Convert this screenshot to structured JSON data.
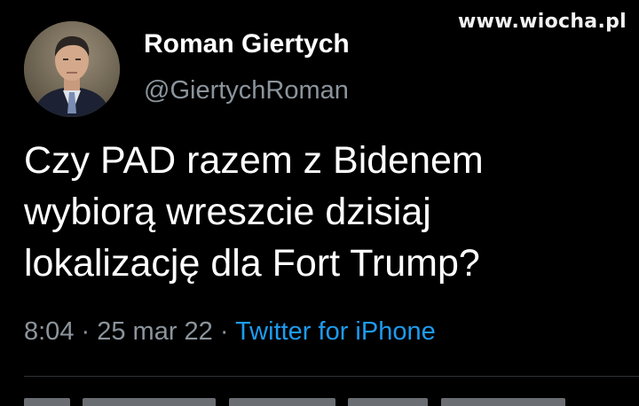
{
  "watermark": "www.wiocha.pl",
  "author": {
    "name": "Roman Giertych",
    "handle": "@GiertychRoman"
  },
  "tweet": {
    "lines": [
      "Czy PAD razem z Bidenem",
      "wybiorą wreszcie dzisiaj",
      "lokalizację dla Fort Trump?"
    ]
  },
  "meta": {
    "time": "8:04",
    "separator": " · ",
    "date": "25 mar 22",
    "source": "Twitter for iPhone"
  },
  "colors": {
    "background": "#000000",
    "primary_text": "#ffffff",
    "secondary_text": "#8b949c",
    "link": "#1d9bf0",
    "divider": "#2f3336"
  }
}
